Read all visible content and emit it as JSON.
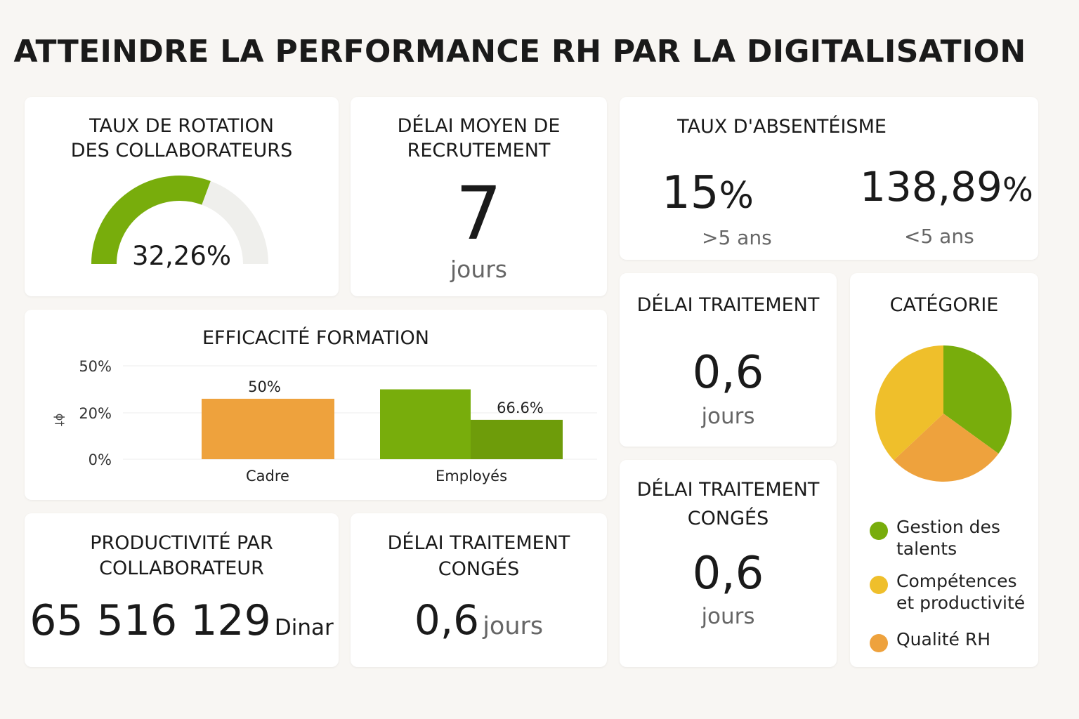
{
  "page": {
    "title": "ATTEINDRE LA PERFORMANCE RH PAR LA DIGITALISATION"
  },
  "colors": {
    "green": "#78ad0c",
    "green_dark": "#6e9c0a",
    "orange": "#eea23d",
    "yellow": "#efbf2b",
    "track": "#efefec"
  },
  "rotation": {
    "title_line1": "TAUX DE ROTATION",
    "title_line2": "DES COLLABORATEURS",
    "value": "32,26%",
    "fill_fraction": 0.3226
  },
  "recrutement": {
    "title_line1": "DÉLAI MOYEN DE",
    "title_line2": "RECRUTEMENT",
    "value": "7",
    "unit": "jours"
  },
  "absenteisme": {
    "title": "TAUX D'ABSENTÉISME",
    "left": {
      "value": "15",
      "pct": "%",
      "label": ">5 ans"
    },
    "right": {
      "value": "138,89",
      "pct": "%",
      "label": "<5 ans"
    }
  },
  "traitement": {
    "title": "DÉLAI TRAITEMENT",
    "value": "0,6",
    "unit": "jours"
  },
  "conges_right": {
    "title_line1": "DÉLAI TRAITEMENT",
    "title_line2": "CONGÉS",
    "value": "0,6",
    "unit": "jours"
  },
  "productivite": {
    "title_line1": "PRODUCTIVITÉ PAR",
    "title_line2": "COLLABORATEUR",
    "value": "65 516 129",
    "unit": "Dinar"
  },
  "conges_bottom": {
    "title_line1": "DÉLAI TRAITEMENT",
    "title_line2": "CONGÉS",
    "value": "0,6",
    "unit": "jours"
  },
  "chart_data": [
    {
      "type": "bar",
      "title": "EFFICACITÉ FORMATION",
      "categories": [
        "Cadre",
        "Employés"
      ],
      "yticks": [
        "0%",
        "20%",
        "50%"
      ],
      "ylim": [
        0,
        50
      ],
      "ylabel_glyph": "ɸ†",
      "series": [
        {
          "values": [
            29,
            35
          ],
          "labels": [
            "50%",
            ""
          ]
        },
        {
          "values": [
            null,
            17
          ],
          "labels": [
            "",
            "66.6%"
          ]
        }
      ],
      "grid": true
    },
    {
      "type": "pie",
      "title": "CATÉGORIE",
      "labels": [
        "Gestion des talents",
        "Compétences et productivité",
        "Qualité RH"
      ],
      "legend_lines": [
        [
          "Gestion des",
          "talents"
        ],
        [
          "Compétences",
          "et productivité"
        ],
        [
          "Qualité RH"
        ]
      ],
      "values": [
        35,
        37,
        28
      ],
      "legend": "bottom"
    }
  ]
}
